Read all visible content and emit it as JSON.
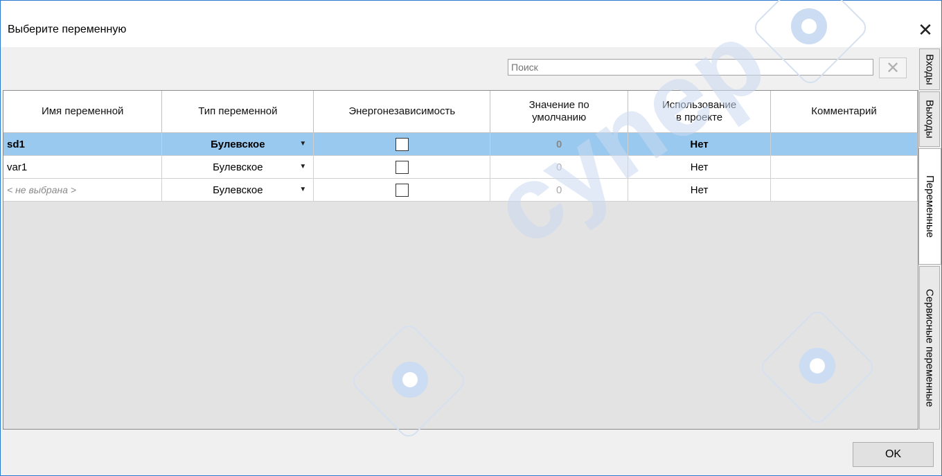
{
  "window": {
    "title": "Выберите переменную",
    "close_glyph": "✕"
  },
  "search": {
    "placeholder": "Поиск",
    "value": "",
    "clear_glyph": "✕"
  },
  "table": {
    "headers": {
      "name": "Имя переменной",
      "type": "Тип переменной",
      "retain": "Энергонезависимость",
      "default_l1": "Значение по",
      "default_l2": "умолчанию",
      "usage_l1": "Использование",
      "usage_l2": "в проекте",
      "comment": "Комментарий"
    },
    "rows": [
      {
        "name": "sd1",
        "type": "Булевское",
        "retain": false,
        "default": "0",
        "usage": "Нет",
        "comment": "",
        "selected": true
      },
      {
        "name": "var1",
        "type": "Булевское",
        "retain": false,
        "default": "0",
        "usage": "Нет",
        "comment": "",
        "selected": false
      },
      {
        "name": "< не выбрана >",
        "type": "Булевское",
        "retain": false,
        "default": "0",
        "usage": "Нет",
        "comment": "",
        "selected": false
      }
    ],
    "dropdown_glyph": "▼"
  },
  "side_tabs": [
    {
      "label": "Входы",
      "active": false
    },
    {
      "label": "Выходы",
      "active": false
    },
    {
      "label": "Переменные",
      "active": true
    },
    {
      "label": "Сервисные переменные",
      "active": false
    }
  ],
  "footer": {
    "ok_label": "OK"
  },
  "watermark": {
    "text": "cynep",
    "color": "#c9d8ef"
  },
  "colors": {
    "selection": "#99c9ef",
    "window_border": "#2b79d0",
    "background": "#f0f0f0"
  }
}
